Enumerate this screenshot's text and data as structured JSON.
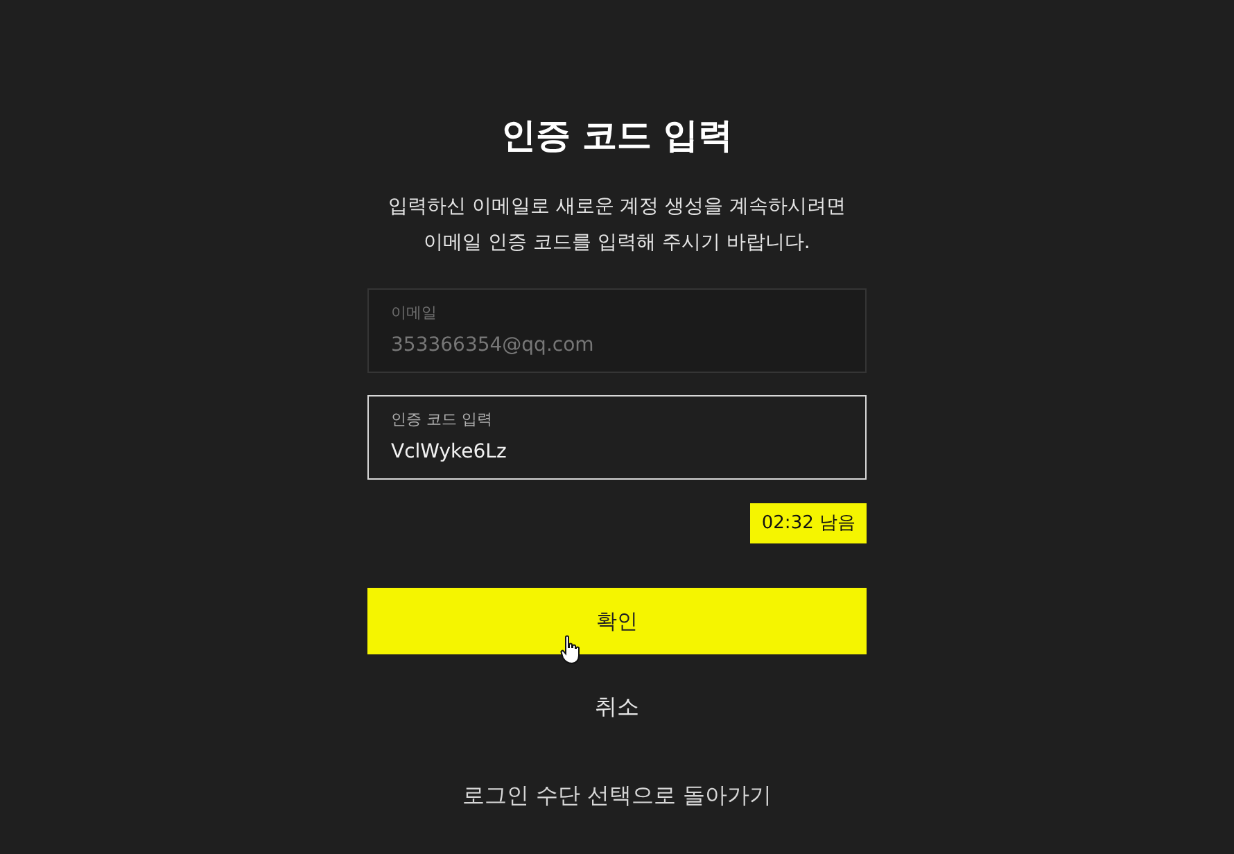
{
  "title": "인증 코드 입력",
  "description": [
    "입력하신 이메일로 새로운 계정 생성을 계속하시려면",
    "이메일 인증 코드를 입력해 주시기 바랍니다."
  ],
  "fields": [
    {
      "label": "이메일",
      "value": "353366354@qq.com",
      "disabled": true,
      "focused": false
    },
    {
      "label": "인증 코드 입력",
      "value": "VclWyke6Lz",
      "disabled": false,
      "focused": true
    }
  ],
  "timer": "02:32 남음",
  "confirm_button": "확인",
  "cancel_button": "취소",
  "back_link": "로그인 수단 선택으로 돌아가기"
}
